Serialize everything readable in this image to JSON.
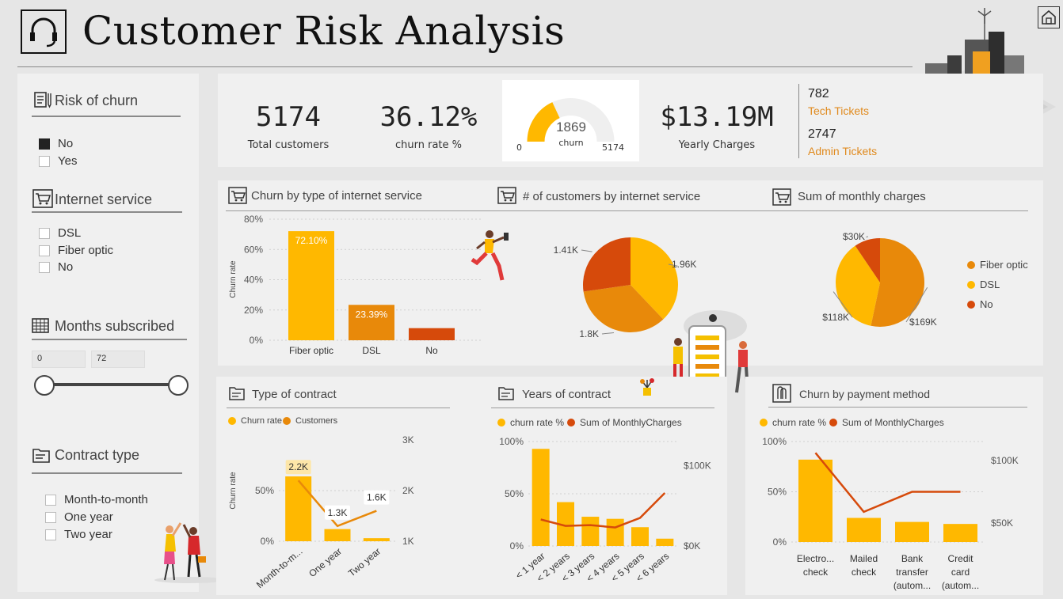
{
  "header": {
    "title": "Customer Risk Analysis"
  },
  "filters": {
    "risk": {
      "title": "Risk of churn",
      "options": [
        {
          "label": "No",
          "checked": true
        },
        {
          "label": "Yes",
          "checked": false
        }
      ]
    },
    "internet": {
      "title": "Internet service",
      "options": [
        {
          "label": "DSL",
          "checked": false
        },
        {
          "label": "Fiber optic",
          "checked": false
        },
        {
          "label": "No",
          "checked": false
        }
      ]
    },
    "months": {
      "title": "Months subscribed",
      "min": "0",
      "max": "72"
    },
    "contract": {
      "title": "Contract type",
      "options": [
        {
          "label": "Month-to-month",
          "checked": false
        },
        {
          "label": "One year",
          "checked": false
        },
        {
          "label": "Two year",
          "checked": false
        }
      ]
    }
  },
  "kpis": {
    "total_customers": {
      "value": "5174",
      "label": "Total customers"
    },
    "churn_rate": {
      "value": "36.12%",
      "label": "churn rate %"
    },
    "gauge": {
      "value": "1869",
      "label": "churn",
      "min": "0",
      "max": "5174",
      "fraction": 0.3612
    },
    "yearly": {
      "value": "$13.19M",
      "label": "Yearly Charges"
    },
    "tech": {
      "value": "782",
      "label": "Tech Tickets"
    },
    "admin": {
      "value": "2747",
      "label": "Admin Tickets"
    }
  },
  "colors": {
    "gold": "#FFB800",
    "orange": "#E8890A",
    "red": "#D64A0B",
    "accent_text": "#E08A1E"
  },
  "icons": {
    "header": "headset-icon",
    "home": "home-icon"
  },
  "chart_data": [
    {
      "id": "churn_by_internet",
      "type": "bar",
      "title": "Churn by type of internet service",
      "ylabel": "Churn rate",
      "ylim": [
        0,
        80
      ],
      "yticks": [
        "0%",
        "20%",
        "40%",
        "60%",
        "80%"
      ],
      "categories": [
        "Fiber optic",
        "DSL",
        "No"
      ],
      "values": [
        72.1,
        23.39,
        8.0
      ],
      "data_labels": [
        "72.10%",
        "23.39%",
        ""
      ],
      "colors": [
        "#FFB800",
        "#E8890A",
        "#D64A0B"
      ]
    },
    {
      "id": "customers_by_internet",
      "type": "pie",
      "title": "# of customers by internet service",
      "slices": [
        {
          "name": "Fiber optic",
          "value": 1.96,
          "label": "1.96K",
          "color": "#FFB800"
        },
        {
          "name": "DSL",
          "value": 1.8,
          "label": "1.8K",
          "color": "#E8890A"
        },
        {
          "name": "No",
          "value": 1.41,
          "label": "1.41K",
          "color": "#D64A0B"
        }
      ]
    },
    {
      "id": "monthly_charges",
      "type": "pie",
      "title": "Sum of monthly charges",
      "legend": [
        "Fiber optic",
        "DSL",
        "No"
      ],
      "slices": [
        {
          "name": "Fiber optic",
          "value": 169,
          "label": "$169K",
          "color": "#E8890A"
        },
        {
          "name": "DSL",
          "value": 118,
          "label": "$118K",
          "color": "#FFB800"
        },
        {
          "name": "No",
          "value": 30,
          "label": "$30K",
          "color": "#D64A0B"
        }
      ]
    },
    {
      "id": "type_of_contract",
      "type": "bar",
      "title": "Type of contract",
      "legend": [
        "Churn rate",
        "Customers"
      ],
      "ylabel": "Churn rate",
      "categories": [
        "Month-to-m...",
        "One year",
        "Two year"
      ],
      "series": [
        {
          "name": "Churn rate",
          "values": [
            64,
            12,
            3
          ]
        },
        {
          "name": "Customers",
          "values": [
            2.2,
            1.3,
            1.6
          ],
          "labels": [
            "2.2K",
            "1.3K",
            "1.6K"
          ]
        }
      ],
      "yticks_left": [
        "0%",
        "50%"
      ],
      "yticks_right": [
        "1K",
        "2K",
        "3K"
      ],
      "ylim_left": [
        0,
        100
      ],
      "ylim_right": [
        1,
        3
      ]
    },
    {
      "id": "years_of_contract",
      "type": "bar",
      "title": "Years of contract",
      "legend": [
        "churn rate %",
        "Sum of MonthlyCharges"
      ],
      "categories": [
        "< 1 year",
        "< 2 years",
        "< 3 years",
        "< 4 years",
        "< 5 years",
        "< 6 years"
      ],
      "series": [
        {
          "name": "churn rate %",
          "values": [
            93,
            42,
            28,
            26,
            18,
            7
          ]
        },
        {
          "name": "Sum of MonthlyCharges",
          "values": [
            33,
            25,
            26,
            23,
            35,
            66
          ]
        }
      ],
      "yticks_left": [
        "0%",
        "50%",
        "100%"
      ],
      "yticks_right": [
        "$0K",
        "$100K"
      ],
      "ylim_left": [
        0,
        100
      ],
      "ylim_right": [
        0,
        130
      ]
    },
    {
      "id": "churn_by_payment",
      "type": "bar",
      "title": "Churn by payment method",
      "legend": [
        "churn rate %",
        "Sum of MonthlyCharges"
      ],
      "categories": [
        "Electro... check",
        "Mailed check",
        "Bank transfer (autom...",
        "Credit card (autom..."
      ],
      "series": [
        {
          "name": "churn rate %",
          "values": [
            82,
            24,
            20,
            18
          ]
        },
        {
          "name": "Sum of MonthlyCharges",
          "values": [
            106,
            59,
            75,
            75
          ]
        }
      ],
      "yticks_left": [
        "0%",
        "50%",
        "100%"
      ],
      "yticks_right": [
        "$50K",
        "$100K"
      ],
      "ylim_left": [
        0,
        100
      ],
      "ylim_right": [
        35,
        115
      ]
    }
  ]
}
